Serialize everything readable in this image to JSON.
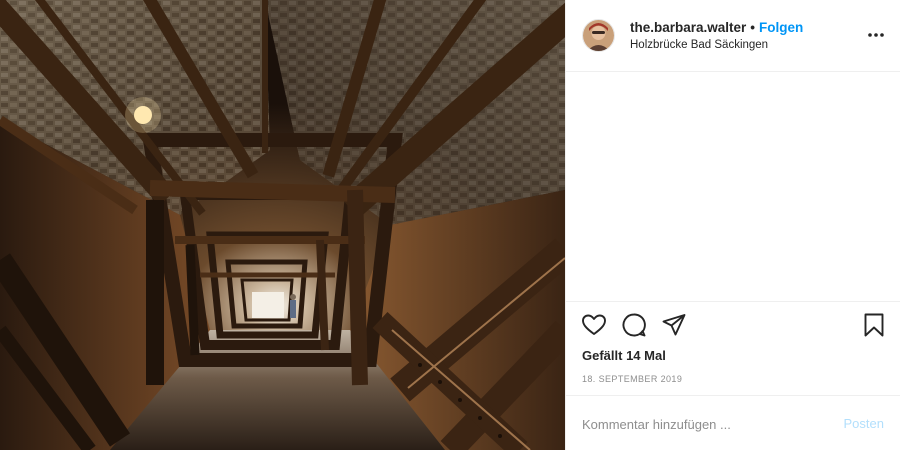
{
  "post": {
    "image_alt": "covered wooden bridge interior",
    "author": {
      "username": "the.barbara.walter",
      "separator": "•",
      "follow_label": "Folgen",
      "location": "Holzbrücke Bad Säckingen",
      "avatar_icon": "avatar-photo"
    },
    "more_icon": "more-options-icon",
    "actions": {
      "like_icon": "heart-icon",
      "comment_icon": "comment-icon",
      "share_icon": "share-icon",
      "save_icon": "bookmark-icon"
    },
    "likes_text": "Gefällt 14 Mal",
    "date_text": "18. SEPTEMBER 2019",
    "comment_box": {
      "placeholder": "Kommentar hinzufügen ...",
      "post_label": "Posten"
    },
    "colors": {
      "accent": "#0095f6",
      "post_disabled": "#b2dffc",
      "muted": "#8e8e8e"
    }
  }
}
